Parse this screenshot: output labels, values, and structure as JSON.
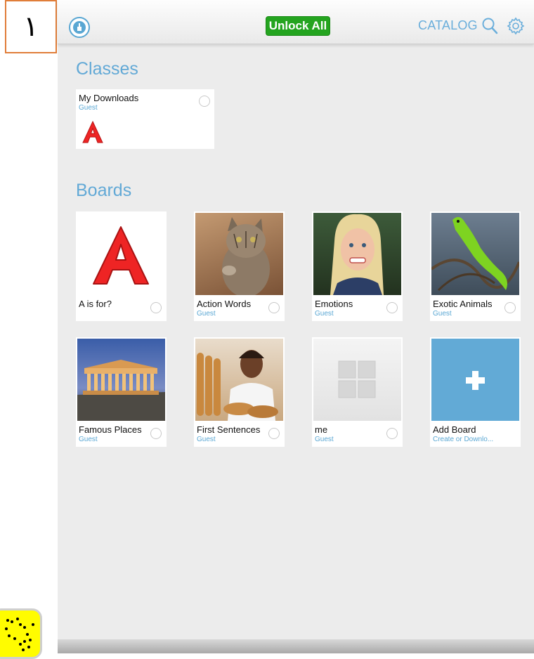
{
  "page_marker": "١",
  "topbar": {
    "unlock_label": "Unlock All",
    "catalog_label": "CATALOG",
    "accent": "#5aa7d3",
    "unlock_color": "#24a41f"
  },
  "classes": {
    "title": "Classes",
    "items": [
      {
        "name": "My Downloads",
        "owner": "Guest",
        "icon": "letter-a-icon"
      }
    ]
  },
  "boards": {
    "title": "Boards",
    "items": [
      {
        "name": "A is for?",
        "owner": "",
        "image": "letter-a"
      },
      {
        "name": "Action Words",
        "owner": "Guest",
        "image": "cat-photo"
      },
      {
        "name": "Emotions",
        "owner": "Guest",
        "image": "girl-photo"
      },
      {
        "name": "Exotic Animals",
        "owner": "Guest",
        "image": "lizard-photo"
      },
      {
        "name": "Famous Places",
        "owner": "Guest",
        "image": "parthenon-photo"
      },
      {
        "name": "First Sentences",
        "owner": "Guest",
        "image": "baker-photo"
      },
      {
        "name": "me",
        "owner": "Guest",
        "image": "placeholder-grid"
      },
      {
        "name": "Add Board",
        "owner": "Create or Downlo...",
        "image": "plus-icon"
      }
    ]
  }
}
